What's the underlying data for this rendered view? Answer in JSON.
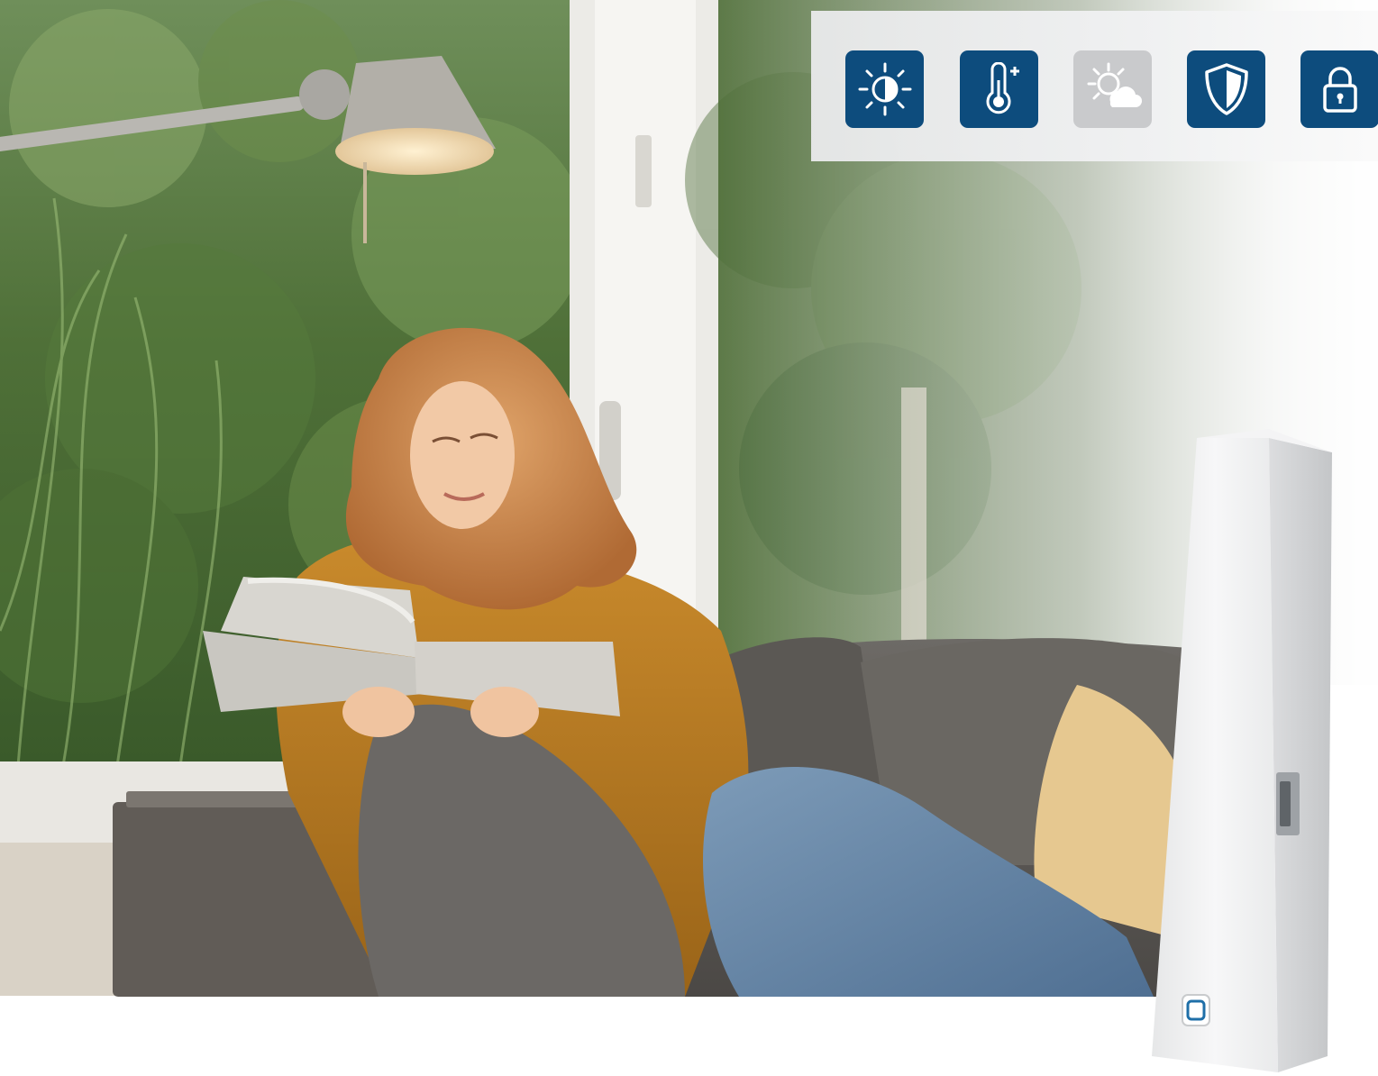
{
  "scene": {
    "subject": "woman",
    "props": [
      "floor-lamp",
      "window",
      "sofa",
      "book",
      "cushion",
      "armrest"
    ]
  },
  "icon_bar": {
    "tiles": [
      {
        "icon": "brightness-icon",
        "state": "active",
        "color": "#0d4c7d"
      },
      {
        "icon": "thermometer-plus-icon",
        "state": "active",
        "color": "#0d4c7d"
      },
      {
        "icon": "sun-cloud-icon",
        "state": "inactive",
        "color": "#c9cacc"
      },
      {
        "icon": "security-shield-icon",
        "state": "active",
        "color": "#0d4c7d"
      },
      {
        "icon": "padlock-icon",
        "state": "active",
        "color": "#0d4c7d"
      }
    ]
  },
  "device": {
    "name": "window-contact-sensor",
    "body_color": "#f1f2f3",
    "button_color": "#1f6fa8"
  }
}
